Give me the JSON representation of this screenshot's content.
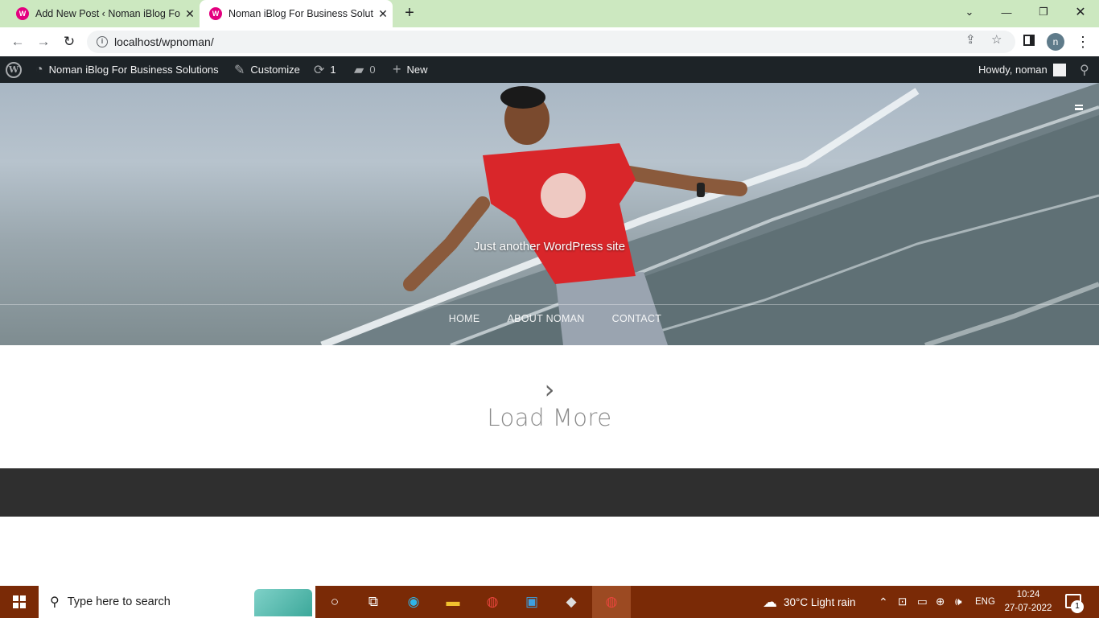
{
  "browser": {
    "tabs": [
      {
        "title": "Add New Post ‹ Noman iBlog For Business Solutions — WordPress",
        "active": false
      },
      {
        "title": "Noman iBlog For Business Solutions",
        "active": true
      }
    ],
    "favicon_letter": "W",
    "url": "localhost/wpnoman/",
    "profile_initial": "n"
  },
  "admin_bar": {
    "site_name": "Noman iBlog For Business Solutions",
    "customize": "Customize",
    "updates_count": "1",
    "comments_count": "0",
    "new_label": "New",
    "howdy": "Howdy, noman"
  },
  "hero": {
    "tagline": "Just another WordPress site",
    "nav": [
      "HOME",
      "ABOUT NOMAN",
      "CONTACT"
    ]
  },
  "content": {
    "load_more": "Load More"
  },
  "taskbar": {
    "search_placeholder": "Type here to search",
    "weather": "30°C  Light rain",
    "language": "ENG",
    "time": "10:24",
    "date": "27-07-2022",
    "notification_count": "1"
  },
  "colors": {
    "tab_strip": "#cce8c0",
    "admin_bar": "#1d2327",
    "footer": "#2f2f2f",
    "taskbar": "#7a2a06",
    "shirt_red": "#d9262a"
  }
}
